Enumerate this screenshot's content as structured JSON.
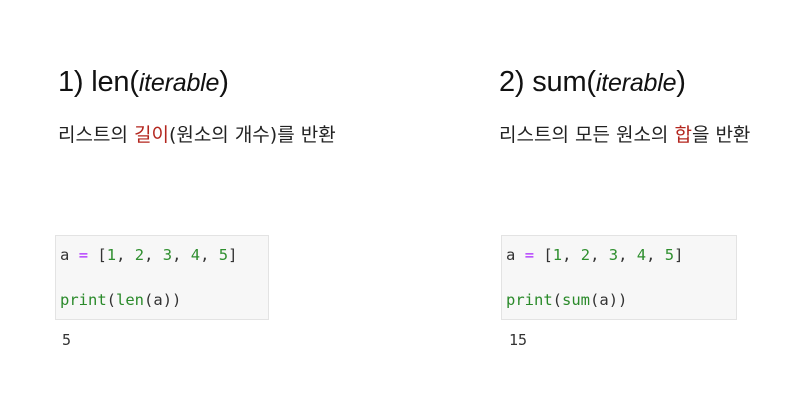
{
  "left": {
    "title_prefix": "1) len(",
    "title_arg": "iterable",
    "title_suffix": ")",
    "desc_before": "리스트의 ",
    "desc_highlight": "길이",
    "desc_after": "(원소의 개수)를 반환",
    "code": {
      "line1": {
        "var": "a",
        "op": "=",
        "open": "[",
        "nums": [
          "1",
          "2",
          "3",
          "4",
          "5"
        ],
        "close": "]"
      },
      "line2": {
        "fn1": "print",
        "p1": "(",
        "fn2": "len",
        "p2": "(",
        "arg": "a",
        "p3": "))"
      }
    },
    "output": "5"
  },
  "right": {
    "title_prefix": "2) sum(",
    "title_arg": "iterable",
    "title_suffix": ")",
    "desc_before": "리스트의 모든 원소의 ",
    "desc_highlight": "합",
    "desc_after": "을 반환",
    "code": {
      "line1": {
        "var": "a",
        "op": "=",
        "open": "[",
        "nums": [
          "1",
          "2",
          "3",
          "4",
          "5"
        ],
        "close": "]"
      },
      "line2": {
        "fn1": "print",
        "p1": "(",
        "fn2": "sum",
        "p2": "(",
        "arg": "a",
        "p3": "))"
      }
    },
    "output": "15"
  },
  "colors": {
    "highlight": "#b3261e",
    "operator": "#aa22ff",
    "number": "#2f8f2f"
  }
}
